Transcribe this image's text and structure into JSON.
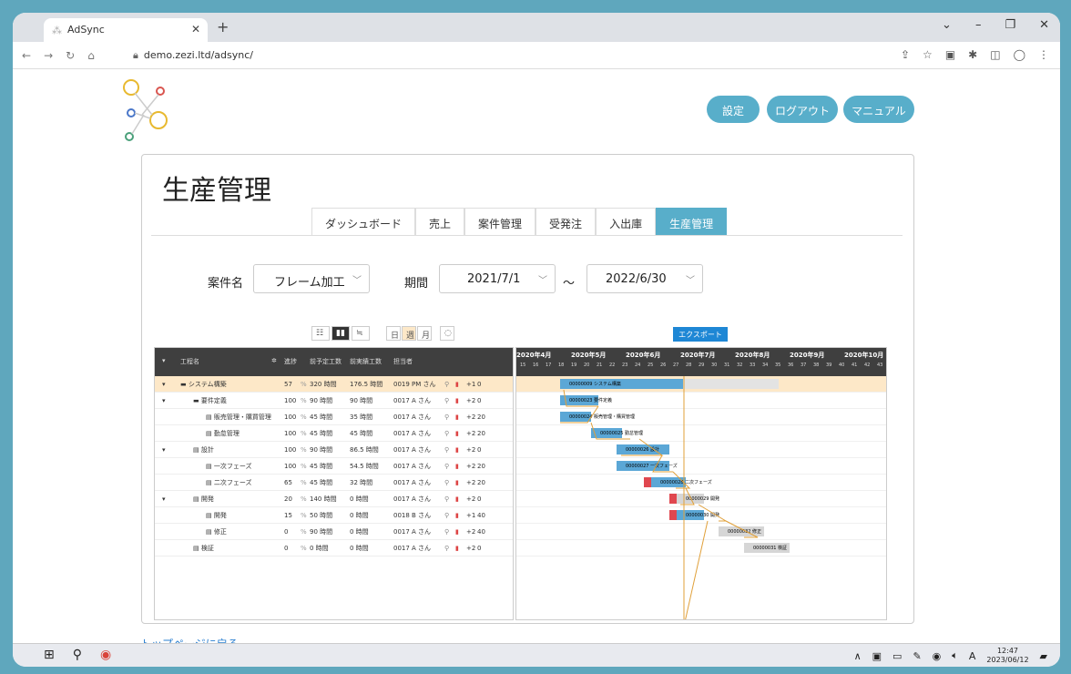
{
  "browser": {
    "tab_title": "AdSync",
    "url": "demo.zezi.ltd/adsync/"
  },
  "header_buttons": {
    "settings": "設定",
    "logout": "ログアウト",
    "manual": "マニュアル"
  },
  "page_title": "生産管理",
  "tabs": [
    {
      "label": "ダッシュボード",
      "active": false
    },
    {
      "label": "売上",
      "active": false
    },
    {
      "label": "案件管理",
      "active": false
    },
    {
      "label": "受発注",
      "active": false
    },
    {
      "label": "入出庫",
      "active": false
    },
    {
      "label": "生産管理",
      "active": true
    }
  ],
  "filters": {
    "project_label": "案件名",
    "project_value": "フレーム加工",
    "period_label": "期間",
    "from_value": "2021/7/1",
    "tilde": "～",
    "to_value": "2022/6/30"
  },
  "gantt_toolbar": {
    "day": "日",
    "week": "週",
    "month": "月",
    "export": "エクスポート"
  },
  "grid_headers": [
    "工程名",
    "進捗",
    "前予定工数",
    "前実績工数",
    "担当者"
  ],
  "rows": [
    {
      "name": "システム構築",
      "progress": "57",
      "pct": "%",
      "plan": "320 時間",
      "actual": "176.5 時間",
      "owner": "0019 PM さん",
      "dep": "+1",
      "extra": "0"
    },
    {
      "name": "要件定義",
      "progress": "100",
      "pct": "%",
      "plan": "90 時間",
      "actual": "90 時間",
      "owner": "0017 A さん",
      "dep": "+2",
      "extra": "0"
    },
    {
      "name": "販売管理・購買管理",
      "progress": "100",
      "pct": "%",
      "plan": "45 時間",
      "actual": "35 時間",
      "owner": "0017 A さん",
      "dep": "+2",
      "extra": "20"
    },
    {
      "name": "勤怠管理",
      "progress": "100",
      "pct": "%",
      "plan": "45 時間",
      "actual": "45 時間",
      "owner": "0017 A さん",
      "dep": "+2",
      "extra": "20"
    },
    {
      "name": "設計",
      "progress": "100",
      "pct": "%",
      "plan": "90 時間",
      "actual": "86.5 時間",
      "owner": "0017 A さん",
      "dep": "+2",
      "extra": "0"
    },
    {
      "name": "一次フェーズ",
      "progress": "100",
      "pct": "%",
      "plan": "45 時間",
      "actual": "54.5 時間",
      "owner": "0017 A さん",
      "dep": "+2",
      "extra": "20"
    },
    {
      "name": "二次フェーズ",
      "progress": "65",
      "pct": "%",
      "plan": "45 時間",
      "actual": "32 時間",
      "owner": "0017 A さん",
      "dep": "+2",
      "extra": "20"
    },
    {
      "name": "開発",
      "progress": "20",
      "pct": "%",
      "plan": "140 時間",
      "actual": "0 時間",
      "owner": "0017 A さん",
      "dep": "+2",
      "extra": "0"
    },
    {
      "name": "開発",
      "progress": "15",
      "pct": "%",
      "plan": "50 時間",
      "actual": "0 時間",
      "owner": "0018 B さん",
      "dep": "+1",
      "extra": "40"
    },
    {
      "name": "修正",
      "progress": "0",
      "pct": "%",
      "plan": "90 時間",
      "actual": "0 時間",
      "owner": "0017 A さん",
      "dep": "+2",
      "extra": "40"
    },
    {
      "name": "検証",
      "progress": "0",
      "pct": "%",
      "plan": "0 時間",
      "actual": "0 時間",
      "owner": "0017 A さん",
      "dep": "+2",
      "extra": "0"
    }
  ],
  "chart_months": [
    "2020年4月",
    "2020年5月",
    "2020年6月",
    "2020年7月",
    "2020年8月",
    "2020年9月",
    "2020年10月"
  ],
  "chart_weeks": [
    "15",
    "16",
    "17",
    "18",
    "19",
    "20",
    "21",
    "22",
    "23",
    "24",
    "25",
    "26",
    "27",
    "28",
    "29",
    "30",
    "31",
    "32",
    "33",
    "34",
    "35",
    "36",
    "37",
    "38",
    "39",
    "40",
    "41",
    "42",
    "43"
  ],
  "bars": [
    "00000009 システム構築",
    "00000023 要件定義",
    "00000024 販売管理・購買管理",
    "00000025 勤怠管理",
    "00000026 設計",
    "00000027 一次フェーズ",
    "00000028 二次フェーズ",
    "00000029 開発",
    "00000030 開発",
    "00000032 修正",
    "00000031 検証"
  ],
  "back_link": "トップページに戻る",
  "taskbar": {
    "time": "12:47",
    "date": "2023/06/12",
    "ime": "A"
  }
}
